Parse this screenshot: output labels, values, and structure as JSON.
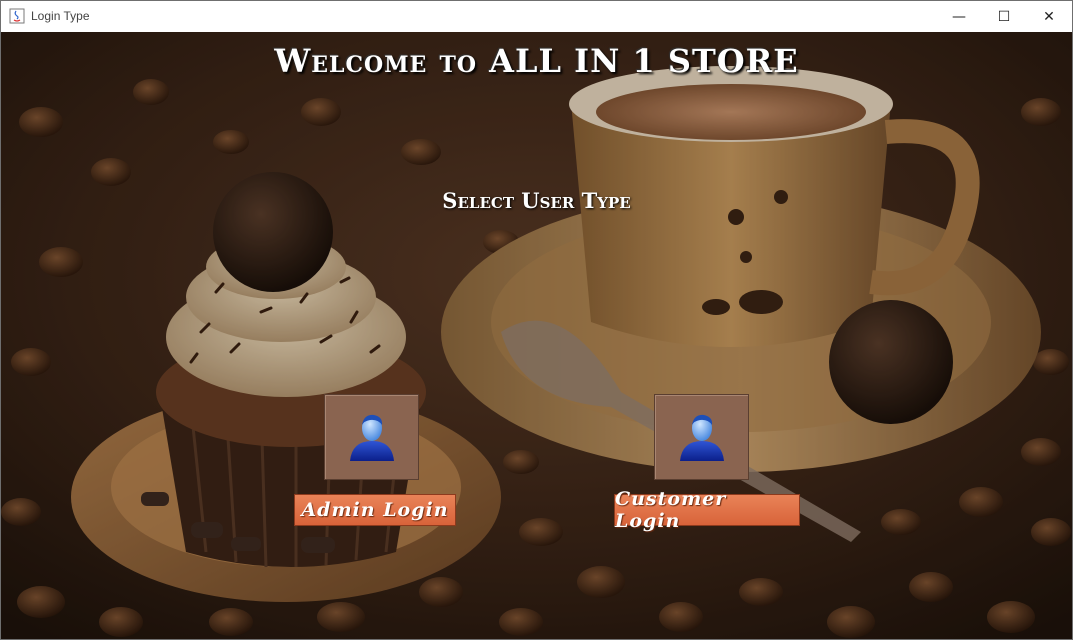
{
  "window": {
    "title": "Login Type",
    "controls": {
      "minimize": "—",
      "maximize": "☐",
      "close": "✕"
    }
  },
  "main": {
    "heading": "Welcome to ALL IN 1 STORE",
    "subheading": "Select User Type",
    "options": [
      {
        "label": "Admin Login",
        "icon": "user-icon"
      },
      {
        "label": "Customer Login",
        "icon": "user-icon"
      }
    ]
  },
  "colors": {
    "button_bg": "#e0703f",
    "tile_bg": "#8a6450",
    "heading_text": "#ffffff"
  }
}
